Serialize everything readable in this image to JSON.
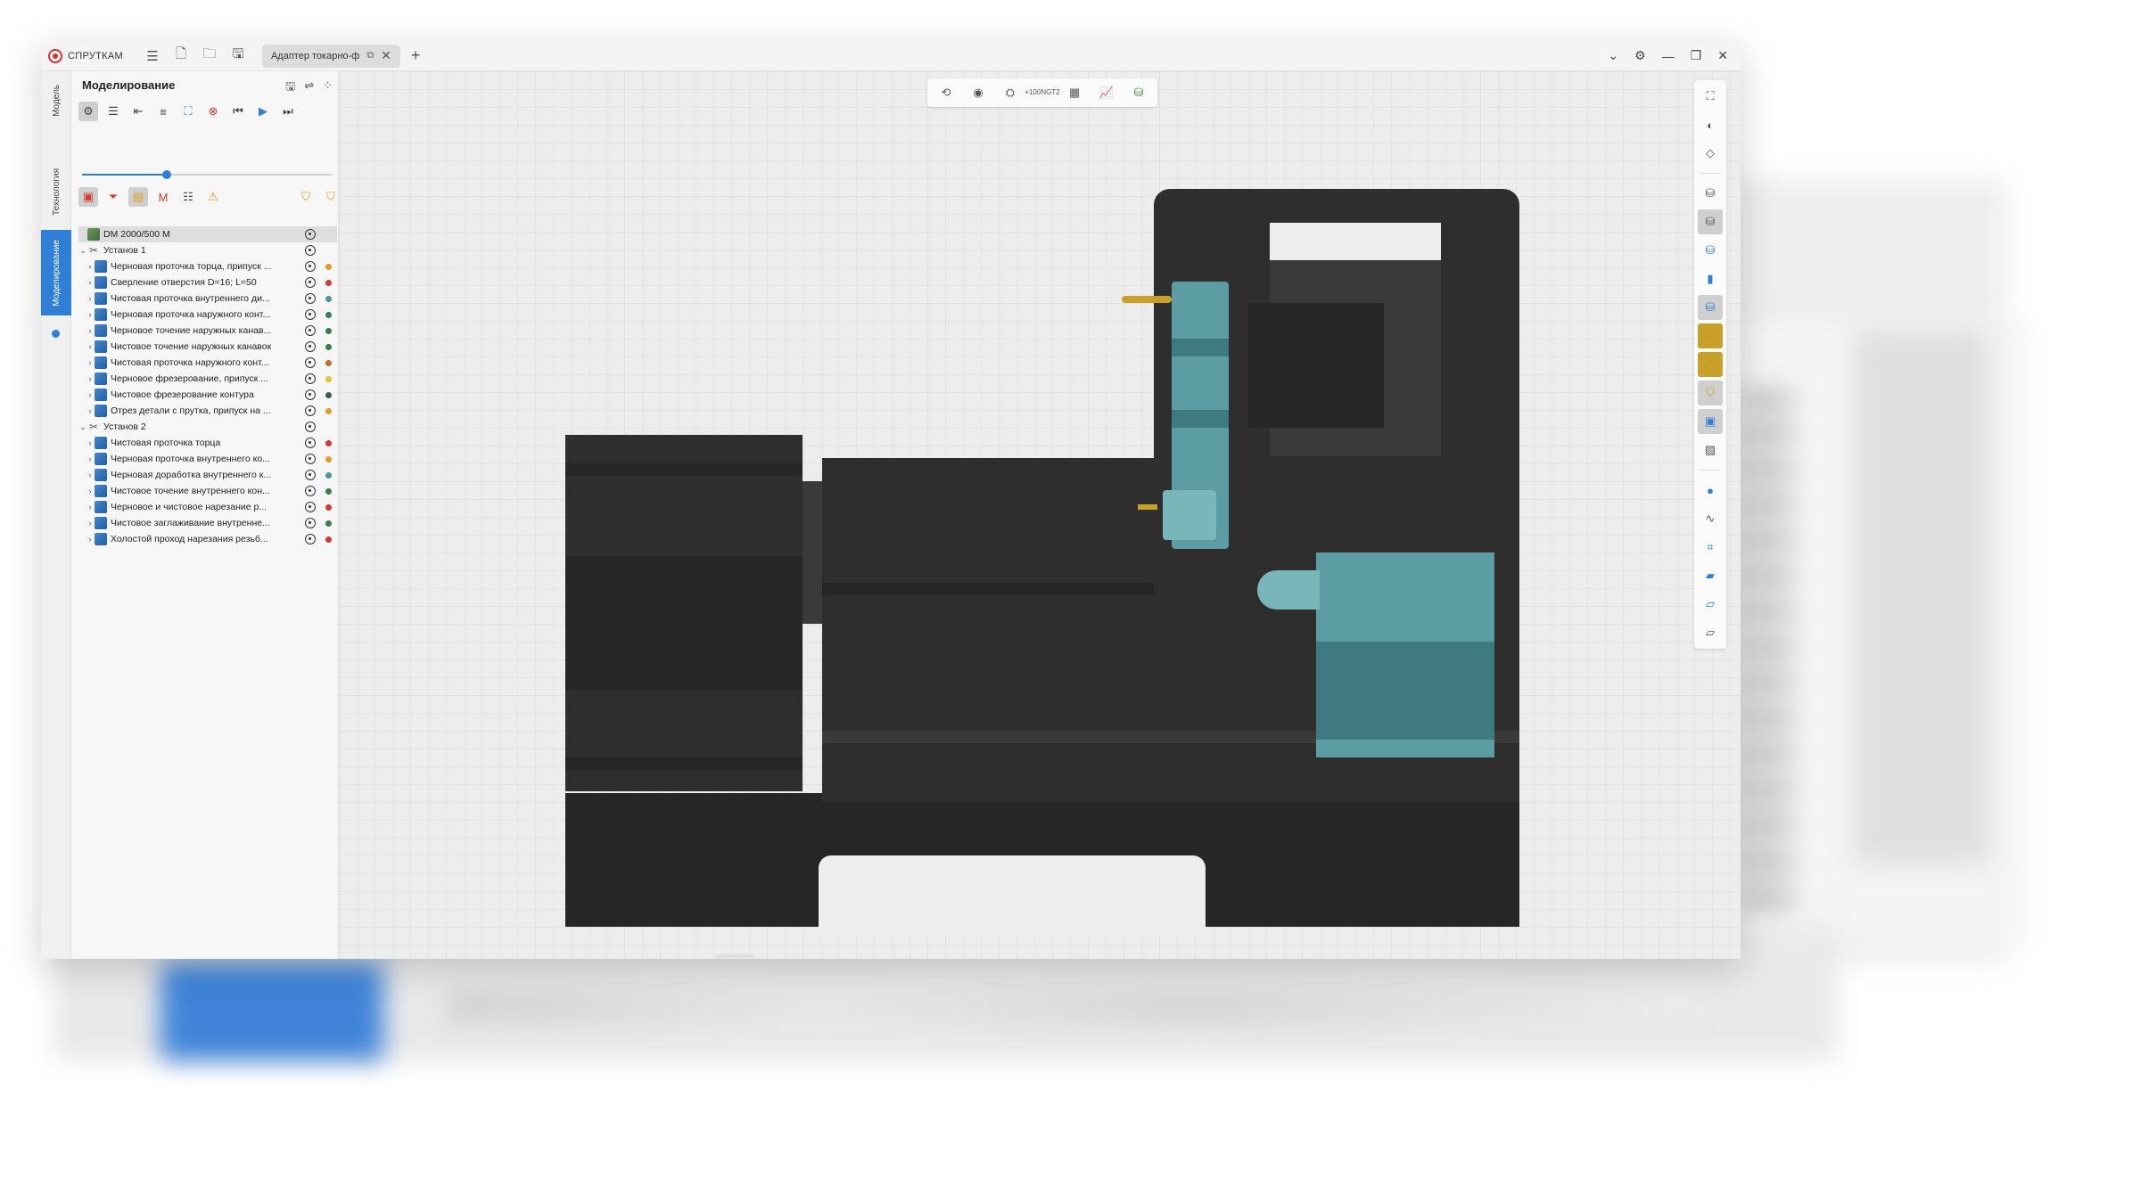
{
  "app": {
    "logo_text": "СПРУТКАМ",
    "document_tab": "Адаптер токарно-ф"
  },
  "vertical_tabs": {
    "model": "Модель",
    "technology": "Технология",
    "simulation": "Моделирование"
  },
  "panel": {
    "title": "Моделирование"
  },
  "simulation_progress": 0.34,
  "tree": {
    "machine": "DM 2000/500 M",
    "setups": [
      {
        "name": "Установ 1",
        "operations": [
          {
            "label": "Черновая проточка торца, припуск ...",
            "status_color": "#e39b22"
          },
          {
            "label": "Сверление отверстия D=16; L=50",
            "status_color": "#d13a31"
          },
          {
            "label": "Чистовая проточка внутреннего ди...",
            "status_color": "#4a9b8f"
          },
          {
            "label": "Черновая проточка наружного конт...",
            "status_color": "#3b7d4f"
          },
          {
            "label": "Черновое точение наружных канав...",
            "status_color": "#3b7d4f"
          },
          {
            "label": "Чистовое точение наружных канавок",
            "status_color": "#3b7d4f"
          },
          {
            "label": "Чистовая проточка наружного конт...",
            "status_color": "#c86a2a"
          },
          {
            "label": "Черновое фрезерование, припуск ...",
            "status_color": "#e8c22a"
          },
          {
            "label": "Чистовое фрезерование контура",
            "status_color": "#3b5d4f"
          },
          {
            "label": "Отрез детали с прутка, припуск на ...",
            "status_color": "#e39b22"
          }
        ]
      },
      {
        "name": "Установ 2",
        "operations": [
          {
            "label": "Чистовая проточка торца",
            "status_color": "#d13a31"
          },
          {
            "label": "Черновая проточка внутреннего ко...",
            "status_color": "#e39b22"
          },
          {
            "label": "Черновая доработка внутреннего к...",
            "status_color": "#4a9b8f"
          },
          {
            "label": "Чистовое точение внутреннего кон...",
            "status_color": "#3b7d4f"
          },
          {
            "label": "Черновое и чистовое нарезание р...",
            "status_color": "#d13a31"
          },
          {
            "label": "Чистовое заглаживание внутренне...",
            "status_color": "#3b7d4f"
          },
          {
            "label": "Холостой проход нарезания резьб...",
            "status_color": "#d13a31"
          }
        ]
      }
    ]
  },
  "viewport_toolbar": {
    "ngt_line1": "+100",
    "ngt_line2": "NGT2"
  },
  "colors": {
    "accent": "#2f7fd6",
    "brand_red": "#d9322b",
    "machine_dark": "#2e2e2e",
    "machine_teal": "#5b9da2"
  }
}
